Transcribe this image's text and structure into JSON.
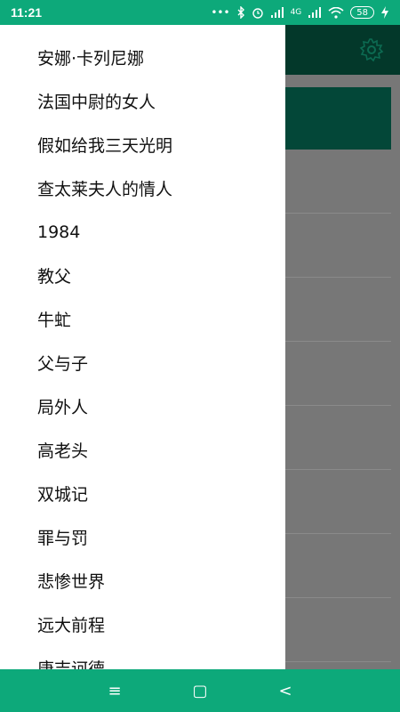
{
  "status_bar": {
    "time": "11:21",
    "dots": "•••",
    "network": "4G",
    "battery": "58",
    "color": "#0da97a"
  },
  "drawer": {
    "items": [
      "安娜·卡列尼娜",
      "法国中尉的女人",
      "假如给我三天光明",
      "查太莱夫人的情人",
      "1984",
      "教父",
      "牛虻",
      "父与子",
      "局外人",
      "高老头",
      "双城记",
      "罪与罚",
      "悲惨世界",
      "远大前程",
      "唐吉诃德"
    ]
  },
  "background": {
    "toolbar_color": "#03382a",
    "settings_icon": "gear-icon"
  },
  "nav_bar": {
    "menu_icon": "≡",
    "home_icon": "▢",
    "back_icon": "<"
  }
}
